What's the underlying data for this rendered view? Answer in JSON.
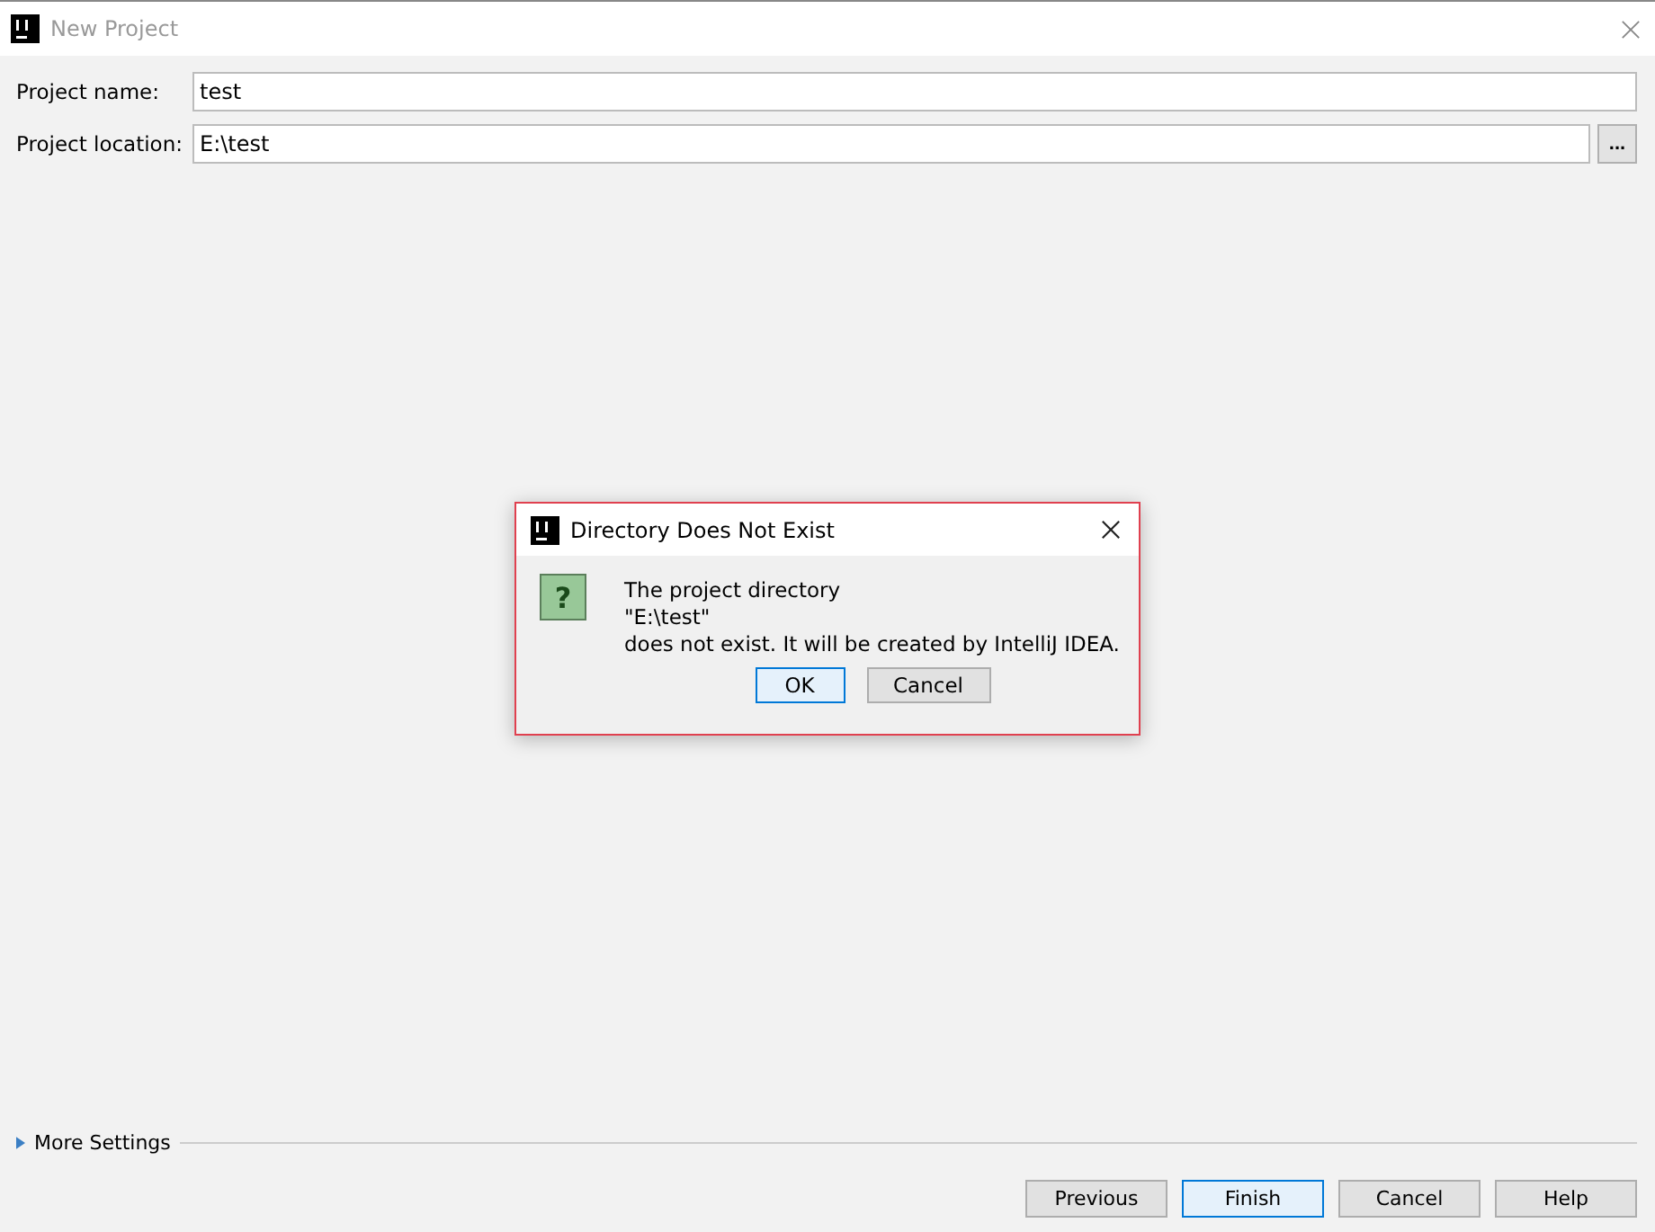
{
  "window": {
    "title": "New Project"
  },
  "fields": [
    {
      "label": "Project name:",
      "value": "test",
      "browse": false
    },
    {
      "label": "Project location:",
      "value": "E:\\test",
      "browse": true,
      "browse_label": "..."
    }
  ],
  "more_settings": {
    "label": "More Settings",
    "expanded": false
  },
  "buttons": [
    {
      "label": "Previous",
      "default": false
    },
    {
      "label": "Finish",
      "default": true
    },
    {
      "label": "Cancel",
      "default": false
    },
    {
      "label": "Help",
      "default": false
    }
  ],
  "dialog": {
    "title": "Directory Does Not Exist",
    "lines": [
      "The project directory",
      "\"E:\\test\"",
      "does not exist. It will be created by IntelliJ IDEA."
    ],
    "icon_glyph": "?",
    "buttons": [
      {
        "label": "OK",
        "default": true
      },
      {
        "label": "Cancel",
        "default": false
      }
    ]
  }
}
